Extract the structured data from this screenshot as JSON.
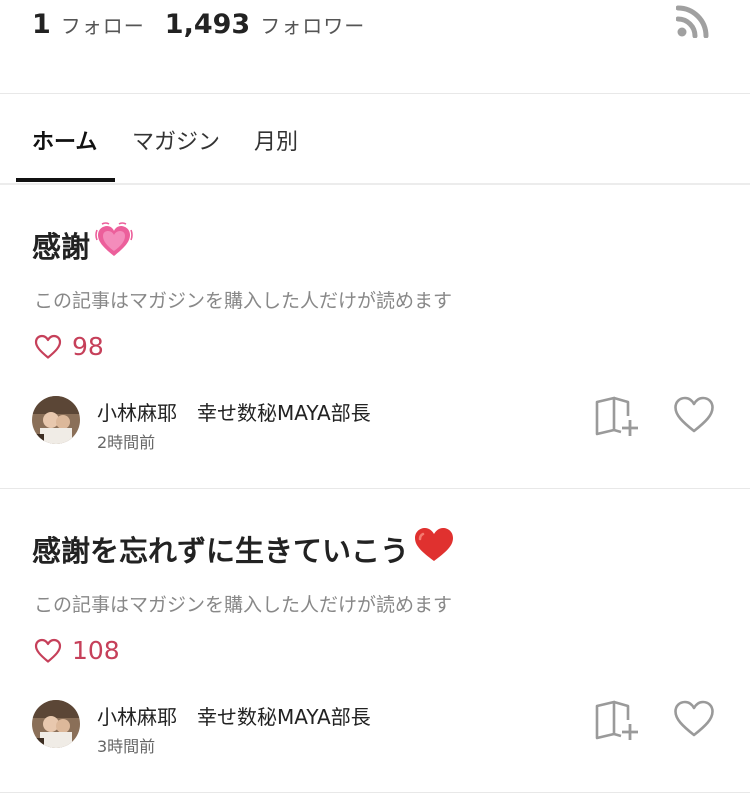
{
  "profile_stats": {
    "following_count": "1",
    "following_label": "フォロー",
    "followers_count": "1,493",
    "followers_label": "フォロワー",
    "rss_icon": "rss-icon"
  },
  "tabs": [
    {
      "label": "ホーム",
      "active": true
    },
    {
      "label": "マガジン",
      "active": false
    },
    {
      "label": "月別",
      "active": false
    }
  ],
  "posts": [
    {
      "title": "感謝",
      "emoji": "sparkling-heart-icon",
      "note": "この記事はマガジンを購入した人だけが読めます",
      "likes": "98",
      "author": "小林麻耶　幸せ数秘MAYA部長",
      "time": "2時間前"
    },
    {
      "title": "感謝を忘れずに生きていこう",
      "emoji": "red-heart-icon",
      "note": "この記事はマガジンを購入した人だけが読めます",
      "likes": "108",
      "author": "小林麻耶　幸せ数秘MAYA部長",
      "time": "3時間前"
    }
  ],
  "colors": {
    "like_red": "#c6405a",
    "icon_gray": "#9a9a9a",
    "text_dark": "#222222",
    "text_muted": "#888888"
  }
}
